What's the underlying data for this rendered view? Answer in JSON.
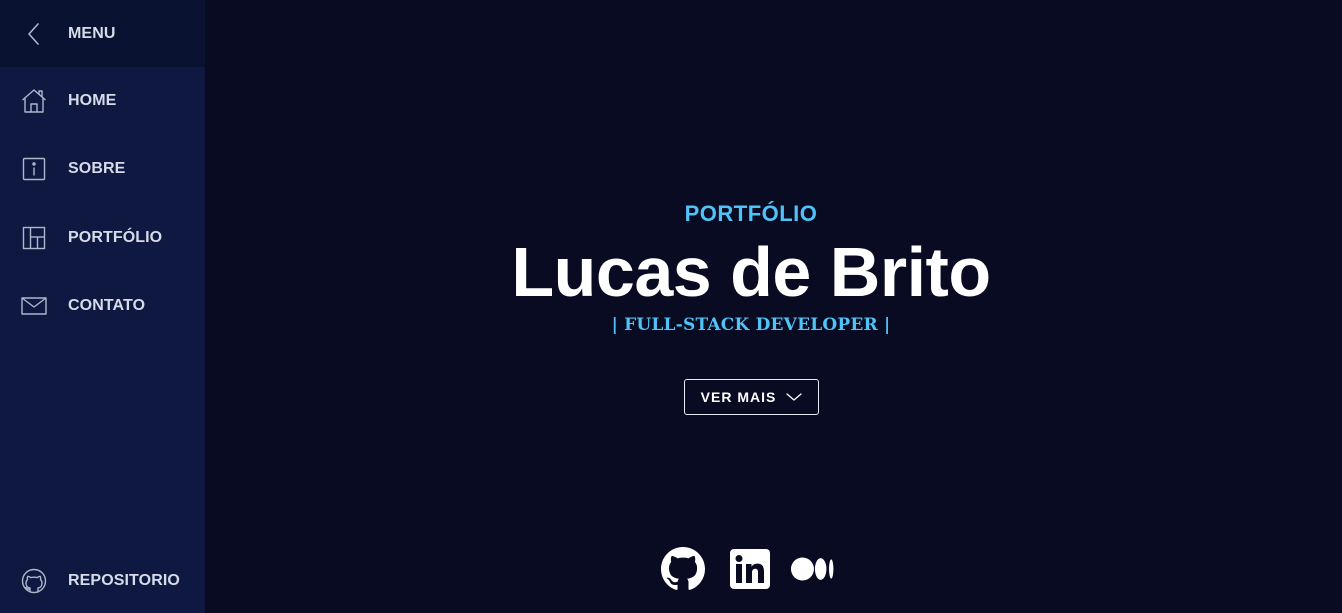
{
  "sidebar": {
    "header": {
      "label": "MENU",
      "icon": "chevron-left-icon"
    },
    "items": [
      {
        "label": "HOME",
        "icon": "home-icon"
      },
      {
        "label": "SOBRE",
        "icon": "info-icon"
      },
      {
        "label": "PORTFÓLIO",
        "icon": "layout-icon"
      },
      {
        "label": "CONTATO",
        "icon": "mail-icon"
      }
    ],
    "footer": {
      "label": "REPOSITORIO",
      "icon": "github-outline-icon"
    }
  },
  "hero": {
    "eyebrow": "PORTFÓLIO",
    "name": "Lucas de Brito",
    "role": "| FULL-STACK DEVELOPER |",
    "button": {
      "label": "VER MAIS",
      "icon": "chevron-down-icon"
    },
    "socials": [
      {
        "icon": "github-icon"
      },
      {
        "icon": "linkedin-icon"
      },
      {
        "icon": "medium-icon"
      }
    ]
  },
  "colors": {
    "background": "#080b21",
    "sidebar": "#0e1840",
    "sidebar_header": "#0a1232",
    "accent": "#4fc3f7",
    "text": "#ffffff",
    "nav_text": "#d7dbe8"
  }
}
